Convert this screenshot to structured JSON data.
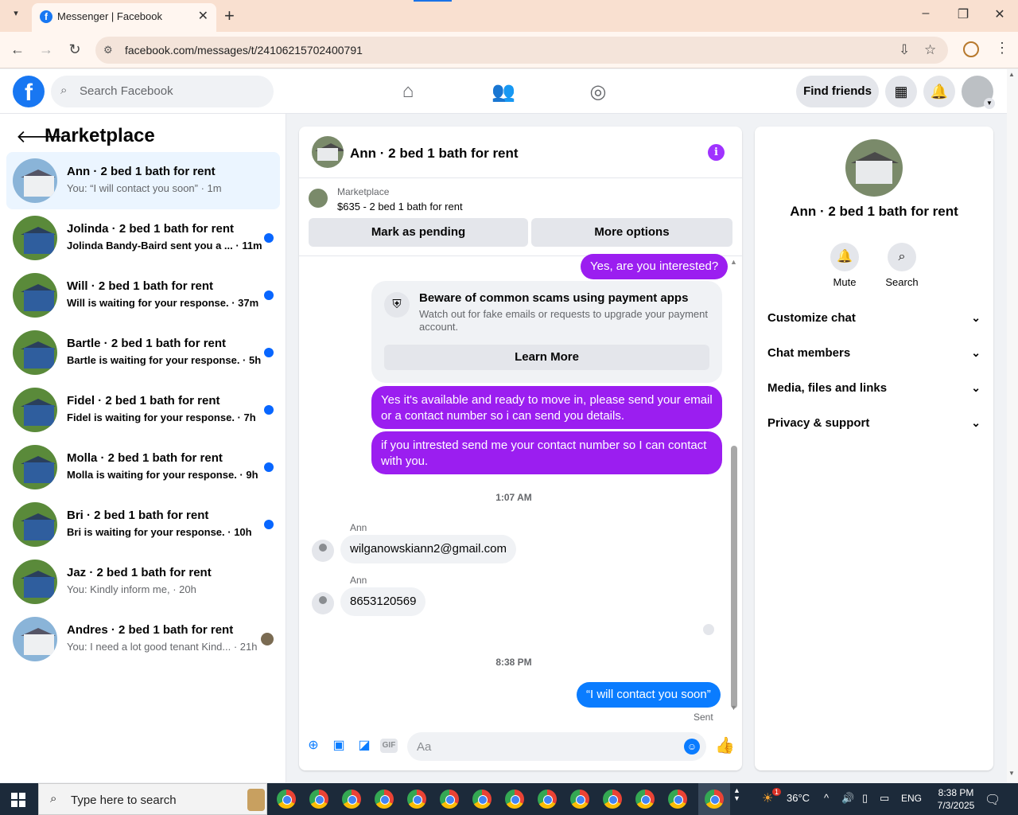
{
  "browser": {
    "tab_title": "Messenger | Facebook",
    "tab_close": "✕",
    "new_tab": "+",
    "url": "facebook.com/messages/t/24106215702400791",
    "window_controls": [
      "–",
      "❐",
      "✕"
    ]
  },
  "fb_header": {
    "logo_letter": "f",
    "search_placeholder": "Search Facebook",
    "find_friends": "Find friends"
  },
  "sidebar": {
    "title": "Marketplace",
    "conversations": [
      {
        "name": "Ann · 2 bed 1 bath for rent",
        "preview": "You: “I will contact you soon” · 1m",
        "unread": false,
        "active": true
      },
      {
        "name": "Jolinda · 2 bed 1 bath for rent",
        "preview": "Jolinda Bandy-Baird sent you a ... · 11m",
        "unread": true
      },
      {
        "name": "Will · 2 bed 1 bath for rent",
        "preview": "Will is waiting for your response. · 37m",
        "unread": true
      },
      {
        "name": "Bartle · 2 bed 1 bath for rent",
        "preview": "Bartle is waiting for your response. · 5h",
        "unread": true
      },
      {
        "name": "Fidel · 2 bed 1 bath for rent",
        "preview": "Fidel is waiting for your response. · 7h",
        "unread": true
      },
      {
        "name": "Molla · 2 bed 1 bath for rent",
        "preview": "Molla is waiting for your response. · 9h",
        "unread": true
      },
      {
        "name": "Bri · 2 bed 1 bath for rent",
        "preview": "Bri is waiting for your response. · 10h",
        "unread": true
      },
      {
        "name": "Jaz · 2 bed 1 bath for rent",
        "preview": "You: Kindly inform me, · 20h",
        "unread": false
      },
      {
        "name": "Andres · 2 bed 1 bath for rent",
        "preview": "You: I need a lot good tenant Kind... · 21h",
        "unread": false
      }
    ]
  },
  "chat": {
    "title": "Ann · 2 bed 1 bath for rent",
    "marketplace_label": "Marketplace",
    "listing": "$635 - 2 bed 1 bath for rent",
    "mark_pending": "Mark as pending",
    "more_options": "More options",
    "msg_interested": "Yes, are you interested?",
    "scam_title": "Beware of common scams using payment apps",
    "scam_body": "Watch out for fake emails or requests to upgrade your payment account.",
    "learn_more": "Learn More",
    "msg_available": "Yes it's available and ready to move in, please send your email or a contact number so i can send you details.",
    "msg_contact": "if you intrested send me your contact number so I can contact with you.",
    "time1": "1:07 AM",
    "sender_name": "Ann",
    "msg_email": "wilganowskiann2@gmail.com",
    "msg_phone": "8653120569",
    "time2": "8:38 PM",
    "msg_reply": "“I will contact you soon”",
    "sent": "Sent",
    "composer_placeholder": "Aa",
    "gif": "GIF"
  },
  "right_panel": {
    "name": "Ann · 2 bed 1 bath for rent",
    "mute": "Mute",
    "search": "Search",
    "rows": [
      "Customize chat",
      "Chat members",
      "Media, files and links",
      "Privacy & support"
    ]
  },
  "taskbar": {
    "search_placeholder": "Type here to search",
    "weather": "36°C",
    "language": "ENG",
    "time": "8:38 PM",
    "date": "7/3/2025",
    "notification_count": "1"
  },
  "colors": {
    "facebook_blue": "#1877f2",
    "bubble_purple": "#9b1ef0",
    "bubble_blue": "#0a7cff",
    "unread_dot": "#0866ff"
  }
}
